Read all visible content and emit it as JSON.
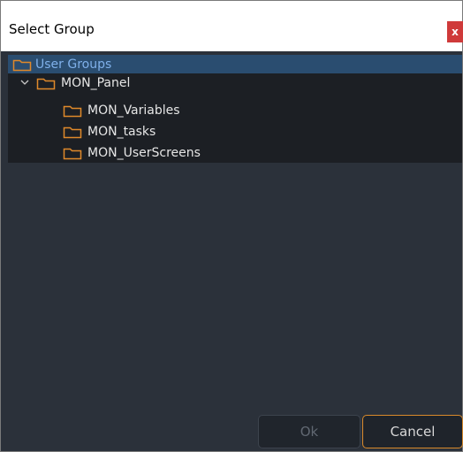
{
  "dialog": {
    "title": "Select Group",
    "close_label": "x"
  },
  "tree": {
    "nodes": [
      {
        "label": "User Groups",
        "selected": true,
        "icon": "folder-icon"
      },
      {
        "label": "MON_Panel",
        "expanded": true,
        "icon": "folder-icon"
      },
      {
        "label": "MON_Variables",
        "icon": "folder-icon"
      },
      {
        "label": "MON_tasks",
        "icon": "folder-icon"
      },
      {
        "label": "MON_UserScreens",
        "icon": "folder-icon"
      }
    ]
  },
  "buttons": {
    "ok_label": "Ok",
    "cancel_label": "Cancel"
  },
  "colors": {
    "background": "#2b313a",
    "tree_background": "#1c1f24",
    "selection": "#2a4d70",
    "folder": "#e0892a",
    "close": "#cf3a3a",
    "cancel_border": "#d98a2b"
  }
}
